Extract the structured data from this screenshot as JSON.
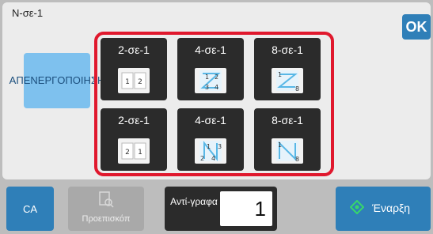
{
  "header": {
    "title": "N-σε-1",
    "ok_label": "OK"
  },
  "disable_button": {
    "label": "ΑΠΕΝΕΡΓΟΠΟΙΗΣΗ"
  },
  "options": [
    {
      "label": "2-σε-1",
      "icon": "two-up-horizontal-icon",
      "row": 1
    },
    {
      "label": "4-σε-1",
      "icon": "four-up-z-order-icon",
      "row": 1
    },
    {
      "label": "8-σε-1",
      "icon": "eight-up-z-order-icon",
      "row": 1
    },
    {
      "label": "2-σε-1",
      "icon": "two-up-reverse-icon",
      "row": 2
    },
    {
      "label": "4-σε-1",
      "icon": "four-up-n-order-icon",
      "row": 2
    },
    {
      "label": "8-σε-1",
      "icon": "eight-up-n-order-icon",
      "row": 2
    }
  ],
  "bottom_bar": {
    "ca_label": "CA",
    "preview_label": "Προεπισκόπ",
    "copies_label": "Αντί-γραφα",
    "copies_value": "1",
    "start_label": "Έναρξη"
  },
  "colors": {
    "accent": "#2f7fb8",
    "highlight_frame": "#e0182d",
    "disable_button": "#7ec1ee",
    "option_tile": "#2b2b2b"
  }
}
